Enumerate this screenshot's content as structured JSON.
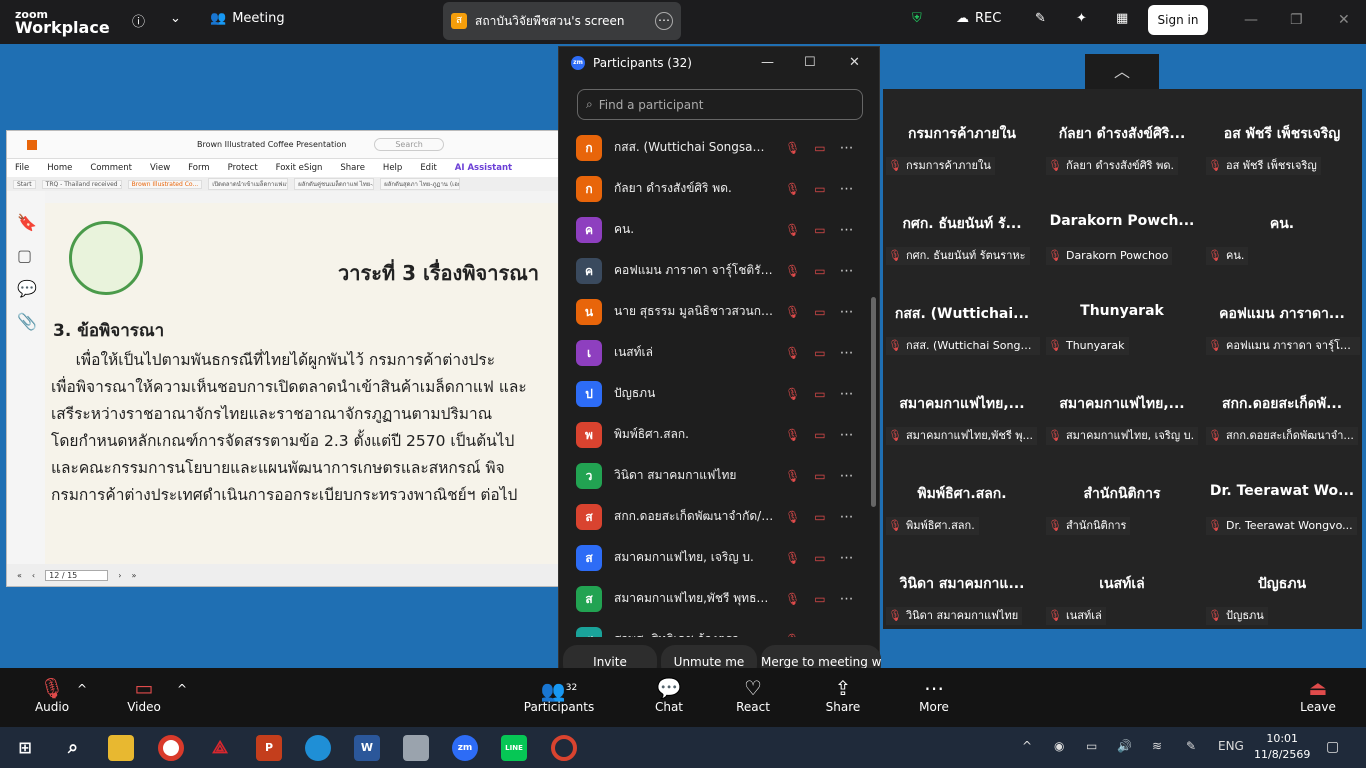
{
  "app": {
    "brand_line1": "zoom",
    "brand_line2": "Workplace",
    "meeting_label": "Meeting",
    "share_title": "สถาบันวิจัยพืชสวน's screen",
    "share_badge": "ส",
    "rec_label": "REC",
    "signin_label": "Sign in"
  },
  "doc": {
    "toolbar_title": "Brown Illustrated Coffee Presentation",
    "search_placeholder": "Search",
    "menu": [
      "File",
      "Home",
      "Comment",
      "View",
      "Form",
      "Protect",
      "Foxit eSign",
      "Share",
      "Help",
      "Edit",
      "AI Assistant"
    ],
    "tabs": [
      "Start",
      "TRQ - Thailand received ...",
      "Brown Illustrated Co...",
      "เปิดตลาดนำเข้าเมล็ดกาแฟแบบ...",
      "ผลักดันคู่ชนเมล็ดกาแฟ ไทย-ภูฏาน (...",
      "ผลักดันสุดภา ไทย-ภูฏาน (เอกสาร..."
    ],
    "slide_title": "วาระที่ 3 เรื่องพิจารณา",
    "section": "3. ข้อพิจารณา",
    "lines": [
      "     เพื่อให้เป็นไปตามพันธกรณีที่ไทยได้ผูกพันไว้ กรมการค้าต่างประ",
      "เพื่อพิจารณาให้ความเห็นชอบการเปิดตลาดนำเข้าสินค้าเมล็ดกาแฟ และ",
      "เสรีระหว่างราชอาณาจักรไทยและราชอาณาจักรภูฏานตามปริมาณ",
      "โดยกำหนดหลักเกณฑ์การจัดสรรตามข้อ 2.3 ตั้งแต่ปี 2570 เป็นต้นไป",
      "และคณะกรรมการนโยบายและแผนพัฒนาการเกษตรและสหกรณ์ พิจ",
      "กรมการค้าต่างประเทศดำเนินการออกระเบียบกระทรวงพาณิชย์ฯ ต่อไป"
    ],
    "page_indicator": "12 / 15"
  },
  "participants": {
    "title": "Participants (32)",
    "search_placeholder": "Find a participant",
    "list": [
      {
        "initial": "ก",
        "name": "กสส. (Wuttichai Songsawat)",
        "color": "#e8650a"
      },
      {
        "initial": "ก",
        "name": "กัลยา ดำรงสังข์ศิริ พด.",
        "color": "#e8650a"
      },
      {
        "initial": "ค",
        "name": "คน.",
        "color": "#8e3fbf"
      },
      {
        "initial": "ค",
        "name": "คอฟแมน ภาราดา จารุ์โชติรัตน์",
        "color": "#3a4a5e"
      },
      {
        "initial": "น",
        "name": "นาย สุธรรม มูลนิธิชาวสวนกาแฟ",
        "color": "#e8650a"
      },
      {
        "initial": "เ",
        "name": "เนสท์เล่",
        "color": "#8e3fbf"
      },
      {
        "initial": "ป",
        "name": "ปัญธภน",
        "color": "#2d6cf6"
      },
      {
        "initial": "พ",
        "name": "พิมพ์ธิศา.สลก.",
        "color": "#d9432f"
      },
      {
        "initial": "ว",
        "name": "วินิดา สมาคมกาแฟไทย",
        "color": "#22a352"
      },
      {
        "initial": "ส",
        "name": "สกก.ดอยสะเก็ดพัฒนาจำกัด/ ป...",
        "color": "#d9432f"
      },
      {
        "initial": "ส",
        "name": "สมาคมกาแฟไทย, เจริญ บ.",
        "color": "#2d6cf6"
      },
      {
        "initial": "ส",
        "name": "สมาคมกาแฟไทย,พัชรี พุทธรวร...",
        "color": "#22a352"
      },
      {
        "initial": "ส",
        "name": "สวพส. สิทธิเดช ก้องตรอ",
        "color": "#1aa39a"
      }
    ],
    "invite_label": "Invite",
    "unmute_label": "Unmute me",
    "merge_label": "Merge to meeting window"
  },
  "gallery": [
    {
      "name": "กรมการค้าภายใน",
      "tag": "กรมการค้าภายใน"
    },
    {
      "name": "กัลยา ดำรงสังข์ศิริ...",
      "tag": "กัลยา ดำรงสังข์ศิริ พด."
    },
    {
      "name": "อส พัชรี เพ็ชรเจริญ",
      "tag": "อส พัชรี เพ็ชรเจริญ"
    },
    {
      "name": "กศก. ธันยนันท์ รั...",
      "tag": "กศก. ธันยนันท์ รัตนราหะ"
    },
    {
      "name": "Darakorn Powch...",
      "tag": "Darakorn Powchoo"
    },
    {
      "name": "คน.",
      "tag": "คน."
    },
    {
      "name": "กสส. (Wuttichai...",
      "tag": "กสส. (Wuttichai Songs..."
    },
    {
      "name": "Thunyarak",
      "tag": "Thunyarak"
    },
    {
      "name": "คอฟแมน ภาราดา...",
      "tag": "คอฟแมน ภาราดา จารุ์โช..."
    },
    {
      "name": "สมาคมกาแฟไทย,...",
      "tag": "สมาคมกาแฟไทย,พัชรี พุ..."
    },
    {
      "name": "สมาคมกาแฟไทย,...",
      "tag": "สมาคมกาแฟไทย, เจริญ บ."
    },
    {
      "name": "สกก.ดอยสะเก็ดพั...",
      "tag": "สกก.ดอยสะเก็ดพัฒนาจำ..."
    },
    {
      "name": "พิมพ์ธิศา.สลก.",
      "tag": "พิมพ์ธิศา.สลก."
    },
    {
      "name": "สำนักนิติการ",
      "tag": "สำนักนิติการ"
    },
    {
      "name": "Dr. Teerawat Wo...",
      "tag": "Dr. Teerawat Wongvo..."
    },
    {
      "name": "วินิดา สมาคมกาแ...",
      "tag": "วินิดา สมาคมกาแฟไทย"
    },
    {
      "name": "เนสท์เล่",
      "tag": "เนสท์เล่"
    },
    {
      "name": "ปัญธภน",
      "tag": "ปัญธภน"
    }
  ],
  "controls": {
    "audio": "Audio",
    "video": "Video",
    "participants": "Participants",
    "participants_count": "32",
    "chat": "Chat",
    "react": "React",
    "share": "Share",
    "more": "More",
    "leave": "Leave"
  },
  "taskbar": {
    "lang": "ENG",
    "time": "10:01",
    "date": "11/8/2569"
  }
}
